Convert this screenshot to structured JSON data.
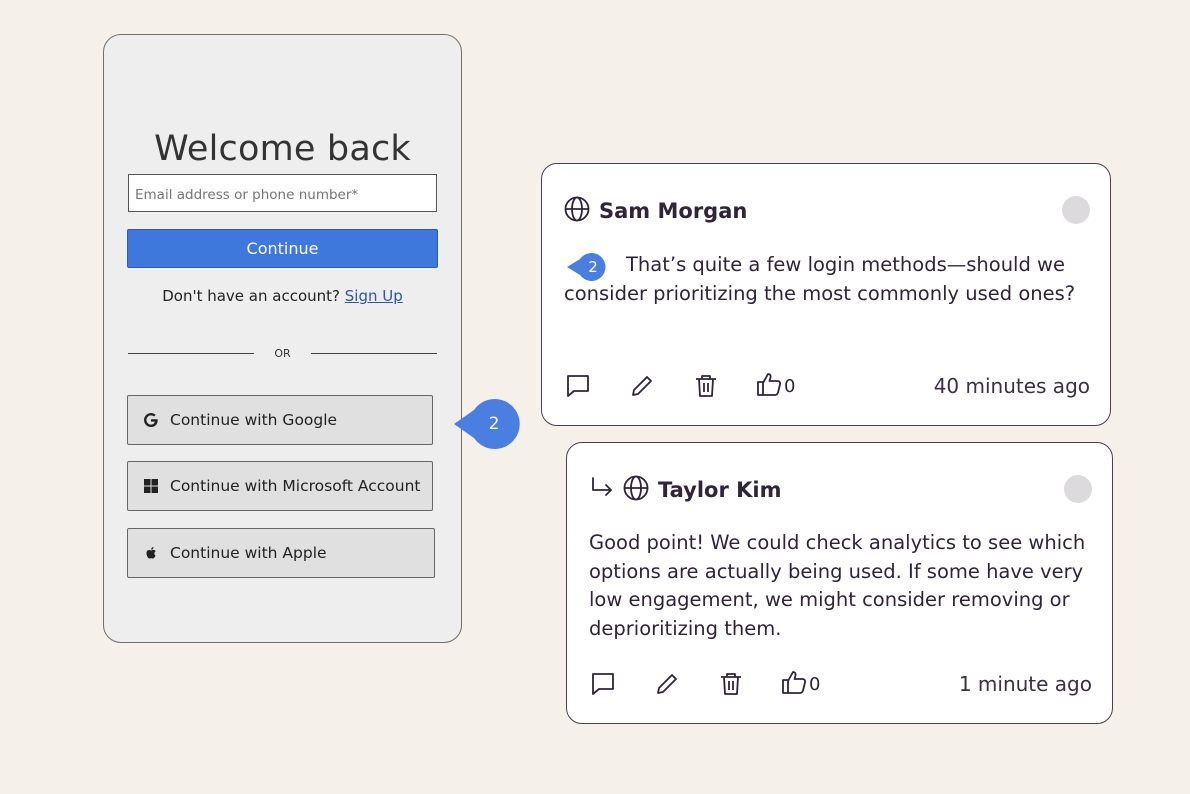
{
  "login": {
    "title": "Welcome back",
    "email_placeholder": "Email address or phone number*",
    "continue_label": "Continue",
    "no_account_text": "Don't have an account?",
    "signup_label": "Sign Up",
    "or_label": "OR",
    "providers": [
      {
        "label": "Continue with Google",
        "icon": "google-icon"
      },
      {
        "label": "Continue with Microsoft Account",
        "icon": "microsoft-icon"
      },
      {
        "label": "Continue with Apple",
        "icon": "apple-icon"
      }
    ]
  },
  "marker": {
    "number": "2",
    "color": "#4a7ee0"
  },
  "comments": [
    {
      "author": "Sam Morgan",
      "marker_number": "2",
      "text": "That’s quite a few login methods—should we consider prioritizing the most commonly used ones?",
      "likes": "0",
      "timestamp": "40 minutes ago"
    },
    {
      "author": "Taylor Kim",
      "text": "Good point! We could check analytics to see which options are actually being used. If some have very low engagement, we might consider removing or deprioritizing them.",
      "likes": "0",
      "timestamp": "1 minute ago"
    }
  ]
}
